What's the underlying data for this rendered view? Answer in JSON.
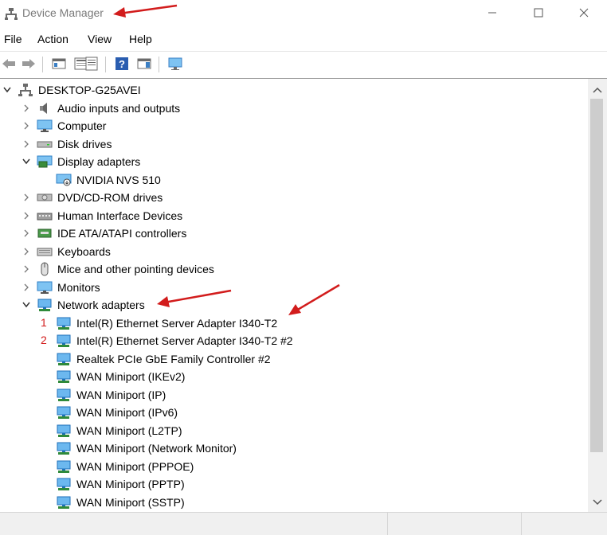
{
  "window": {
    "title": "Device Manager"
  },
  "menu": [
    "File",
    "Action",
    "View",
    "Help"
  ],
  "tree": {
    "root": "DESKTOP-G25AVEI",
    "categories": [
      {
        "label": "Audio inputs and outputs",
        "icon": "speaker-icon",
        "expanded": false
      },
      {
        "label": "Computer",
        "icon": "monitor-icon",
        "expanded": false
      },
      {
        "label": "Disk drives",
        "icon": "disk-drive-icon",
        "expanded": false
      },
      {
        "label": "Display adapters",
        "icon": "display-adapter-icon",
        "expanded": true,
        "children": [
          {
            "label": "NVIDIA NVS 510",
            "icon": "display-adapter-device-icon"
          }
        ]
      },
      {
        "label": "DVD/CD-ROM drives",
        "icon": "dvd-drive-icon",
        "expanded": false
      },
      {
        "label": "Human Interface Devices",
        "icon": "hid-icon",
        "expanded": false
      },
      {
        "label": "IDE ATA/ATAPI controllers",
        "icon": "ide-controller-icon",
        "expanded": false
      },
      {
        "label": "Keyboards",
        "icon": "keyboard-icon",
        "expanded": false
      },
      {
        "label": "Mice and other pointing devices",
        "icon": "mouse-icon",
        "expanded": false
      },
      {
        "label": "Monitors",
        "icon": "monitor-icon",
        "expanded": false
      },
      {
        "label": "Network adapters",
        "icon": "network-adapter-icon",
        "expanded": true,
        "children": [
          {
            "label": "Intel(R) Ethernet Server Adapter I340-T2",
            "marker": "1"
          },
          {
            "label": "Intel(R) Ethernet Server Adapter I340-T2 #2",
            "marker": "2"
          },
          {
            "label": "Realtek PCIe GbE Family Controller #2"
          },
          {
            "label": "WAN Miniport (IKEv2)"
          },
          {
            "label": "WAN Miniport (IP)"
          },
          {
            "label": "WAN Miniport (IPv6)"
          },
          {
            "label": "WAN Miniport (L2TP)"
          },
          {
            "label": "WAN Miniport (Network Monitor)"
          },
          {
            "label": "WAN Miniport (PPPOE)"
          },
          {
            "label": "WAN Miniport (PPTP)"
          },
          {
            "label": "WAN Miniport (SSTP)"
          }
        ]
      }
    ]
  },
  "colors": {
    "annotation": "#d21c1c",
    "icon_blue": "#1e88d6"
  }
}
